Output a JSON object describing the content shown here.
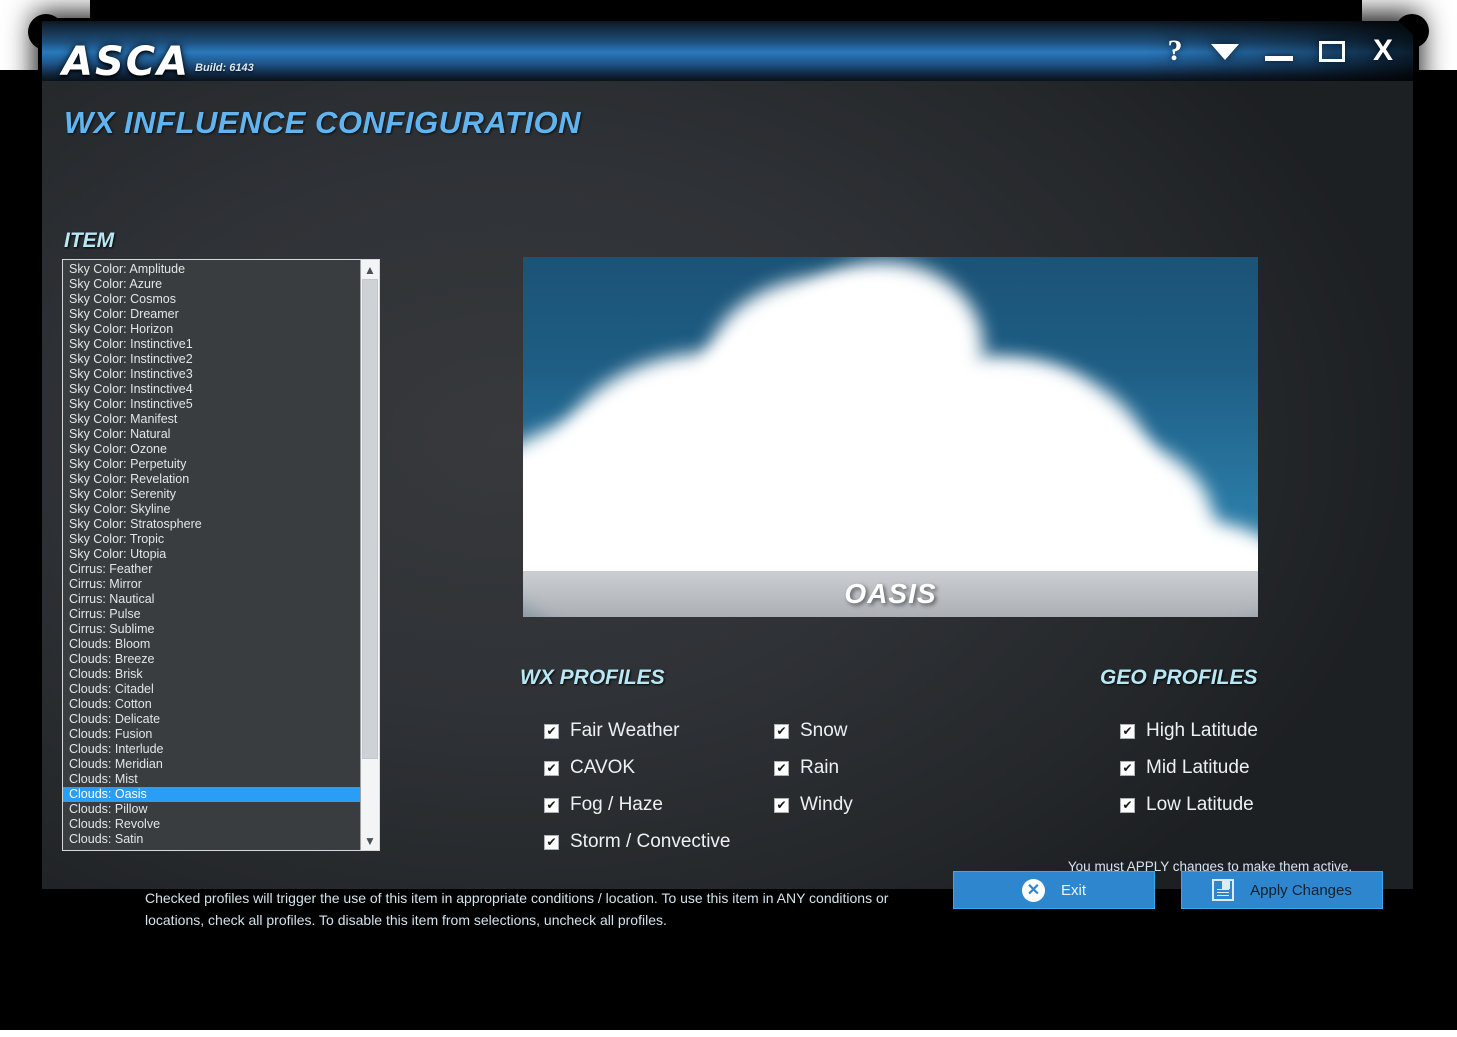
{
  "window": {
    "app_name": "ASCA",
    "build": "Build: 6143",
    "controls": {
      "help": "?",
      "dropdown": "dropdown-arrow",
      "minimize": "minimize",
      "maximize": "maximize",
      "close": "X"
    }
  },
  "page": {
    "title": "WX INFLUENCE CONFIGURATION"
  },
  "item_panel": {
    "label": "ITEM",
    "selected": "Clouds: Oasis",
    "items": [
      "Sky Color: Amplitude",
      "Sky Color: Azure",
      "Sky Color: Cosmos",
      "Sky Color: Dreamer",
      "Sky Color: Horizon",
      "Sky Color: Instinctive1",
      "Sky Color: Instinctive2",
      "Sky Color: Instinctive3",
      "Sky Color: Instinctive4",
      "Sky Color: Instinctive5",
      "Sky Color: Manifest",
      "Sky Color: Natural",
      "Sky Color: Ozone",
      "Sky Color: Perpetuity",
      "Sky Color: Revelation",
      "Sky Color: Serenity",
      "Sky Color: Skyline",
      "Sky Color: Stratosphere",
      "Sky Color: Tropic",
      "Sky Color: Utopia",
      "Cirrus: Feather",
      "Cirrus: Mirror",
      "Cirrus: Nautical",
      "Cirrus: Pulse",
      "Cirrus: Sublime",
      "Clouds: Bloom",
      "Clouds: Breeze",
      "Clouds: Brisk",
      "Clouds: Citadel",
      "Clouds: Cotton",
      "Clouds: Delicate",
      "Clouds: Fusion",
      "Clouds: Interlude",
      "Clouds: Meridian",
      "Clouds: Mist",
      "Clouds: Oasis",
      "Clouds: Pillow",
      "Clouds: Revolve",
      "Clouds: Satin"
    ]
  },
  "preview": {
    "caption": "OASIS",
    "sky_color": "#1d5b86"
  },
  "wx_profiles": {
    "label": "WX PROFILES",
    "column1": [
      {
        "label": "Fair Weather",
        "checked": true
      },
      {
        "label": "CAVOK",
        "checked": true
      },
      {
        "label": "Fog / Haze",
        "checked": true
      },
      {
        "label": "Storm / Convective",
        "checked": true
      }
    ],
    "column2": [
      {
        "label": "Snow",
        "checked": true
      },
      {
        "label": "Rain",
        "checked": true
      },
      {
        "label": "Windy",
        "checked": true
      }
    ]
  },
  "geo_profiles": {
    "label": "GEO PROFILES",
    "items": [
      {
        "label": "High Latitude",
        "checked": true
      },
      {
        "label": "Mid Latitude",
        "checked": true
      },
      {
        "label": "Low Latitude",
        "checked": true
      }
    ]
  },
  "footer": {
    "help_text": "Checked profiles will trigger the use of this item in appropriate conditions / location. To use this item in ANY conditions or locations, check all profiles. To disable this item from selections, uncheck all profiles.",
    "apply_note": "You must APPLY changes to make them active.",
    "exit_button": "Exit",
    "apply_button": "Apply Changes"
  },
  "colors": {
    "accent_blue": "#2a9df4",
    "title_blue": "#60b4f0",
    "section_cyan": "#b8e8f5",
    "button_blue": "#2e86cf"
  }
}
